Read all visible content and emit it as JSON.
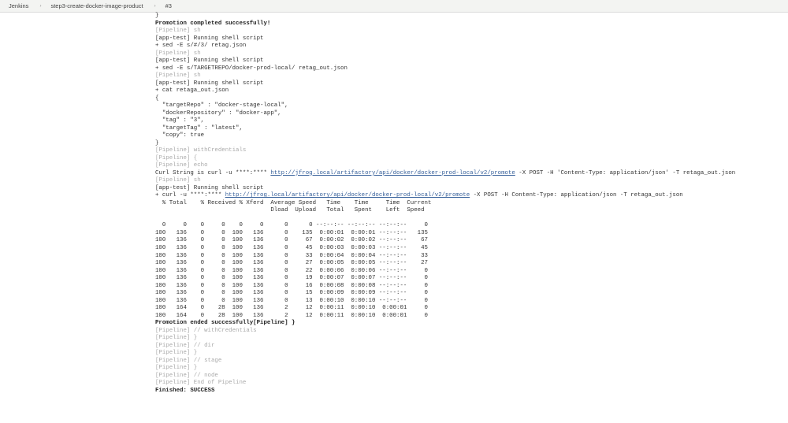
{
  "breadcrumb": {
    "items": [
      "Jenkins",
      "step3-create-docker-image-product",
      "#3"
    ],
    "separator": "›"
  },
  "console": {
    "lines": [
      {
        "text": "}"
      },
      {
        "text": "Promotion completed successfully!",
        "style": "bold"
      },
      {
        "text": "[Pipeline] sh",
        "style": "muted"
      },
      {
        "text": "[app-test] Running shell script"
      },
      {
        "text": "+ sed -E s/#/3/ retag.json"
      },
      {
        "text": "[Pipeline] sh",
        "style": "muted"
      },
      {
        "text": "[app-test] Running shell script"
      },
      {
        "text": "+ sed -E s/TARGETREPO/docker-prod-local/ retag_out.json"
      },
      {
        "text": "[Pipeline] sh",
        "style": "muted"
      },
      {
        "text": "[app-test] Running shell script"
      },
      {
        "text": "+ cat retaga_out.json"
      },
      {
        "text": "{"
      },
      {
        "text": "  \"targetRepo\" : \"docker-stage-local\","
      },
      {
        "text": "  \"dockerRepository\" : \"docker-app\","
      },
      {
        "text": "  \"tag\" : \"3\","
      },
      {
        "text": "  \"targetTag\" : \"latest\","
      },
      {
        "text": "  \"copy\": true"
      },
      {
        "text": "}"
      },
      {
        "text": "[Pipeline] withCredentials",
        "style": "muted"
      },
      {
        "text": "[Pipeline] {",
        "style": "muted"
      },
      {
        "text": "[Pipeline] echo",
        "style": "muted"
      },
      {
        "text": "Curl String is curl -u ****:**** ",
        "link": "http://jfrog.local/artifactory/api/docker/docker-prod-local/v2/promote",
        "post": " -X POST -H 'Content-Type: application/json' -T retaga_out.json"
      },
      {
        "text": "[Pipeline] sh",
        "style": "muted"
      },
      {
        "text": "[app-test] Running shell script"
      },
      {
        "text": "+ curl -u ****:**** ",
        "link": "http://jfrog.local/artifactory/api/docker/docker-prod-local/v2/promote",
        "post": " -X POST -H Content-Type: application/json -T retaga_out.json"
      },
      {
        "text": "  % Total    % Received % Xferd  Average Speed   Time    Time     Time  Current"
      },
      {
        "text": "                                 Dload  Upload   Total   Spent    Left  Speed"
      },
      {
        "text": ""
      },
      {
        "text": "  0     0    0     0    0     0      0      0 --:--:-- --:--:-- --:--:--     0"
      },
      {
        "text": "100   136    0     0  100   136      0    135  0:00:01  0:00:01 --:--:--   135"
      },
      {
        "text": "100   136    0     0  100   136      0     67  0:00:02  0:00:02 --:--:--    67"
      },
      {
        "text": "100   136    0     0  100   136      0     45  0:00:03  0:00:03 --:--:--    45"
      },
      {
        "text": "100   136    0     0  100   136      0     33  0:00:04  0:00:04 --:--:--    33"
      },
      {
        "text": "100   136    0     0  100   136      0     27  0:00:05  0:00:05 --:--:--    27"
      },
      {
        "text": "100   136    0     0  100   136      0     22  0:00:06  0:00:06 --:--:--     0"
      },
      {
        "text": "100   136    0     0  100   136      0     19  0:00:07  0:00:07 --:--:--     0"
      },
      {
        "text": "100   136    0     0  100   136      0     16  0:00:08  0:00:08 --:--:--     0"
      },
      {
        "text": "100   136    0     0  100   136      0     15  0:00:09  0:00:09 --:--:--     0"
      },
      {
        "text": "100   136    0     0  100   136      0     13  0:00:10  0:00:10 --:--:--     0"
      },
      {
        "text": "100   164    0    28  100   136      2     12  0:00:11  0:00:10  0:00:01     0"
      },
      {
        "text": "100   164    0    28  100   136      2     12  0:00:11  0:00:10  0:00:01     0"
      },
      {
        "text": "Promotion ended successfully[Pipeline] }",
        "style": "bold"
      },
      {
        "text": "[Pipeline] // withCredentials",
        "style": "muted"
      },
      {
        "text": "[Pipeline] }",
        "style": "muted"
      },
      {
        "text": "[Pipeline] // dir",
        "style": "muted"
      },
      {
        "text": "[Pipeline] }",
        "style": "muted"
      },
      {
        "text": "[Pipeline] // stage",
        "style": "muted"
      },
      {
        "text": "[Pipeline] }",
        "style": "muted"
      },
      {
        "text": "[Pipeline] // node",
        "style": "muted"
      },
      {
        "text": "[Pipeline] End of Pipeline",
        "style": "muted"
      },
      {
        "text": "Finished: SUCCESS",
        "style": "bold"
      }
    ]
  }
}
